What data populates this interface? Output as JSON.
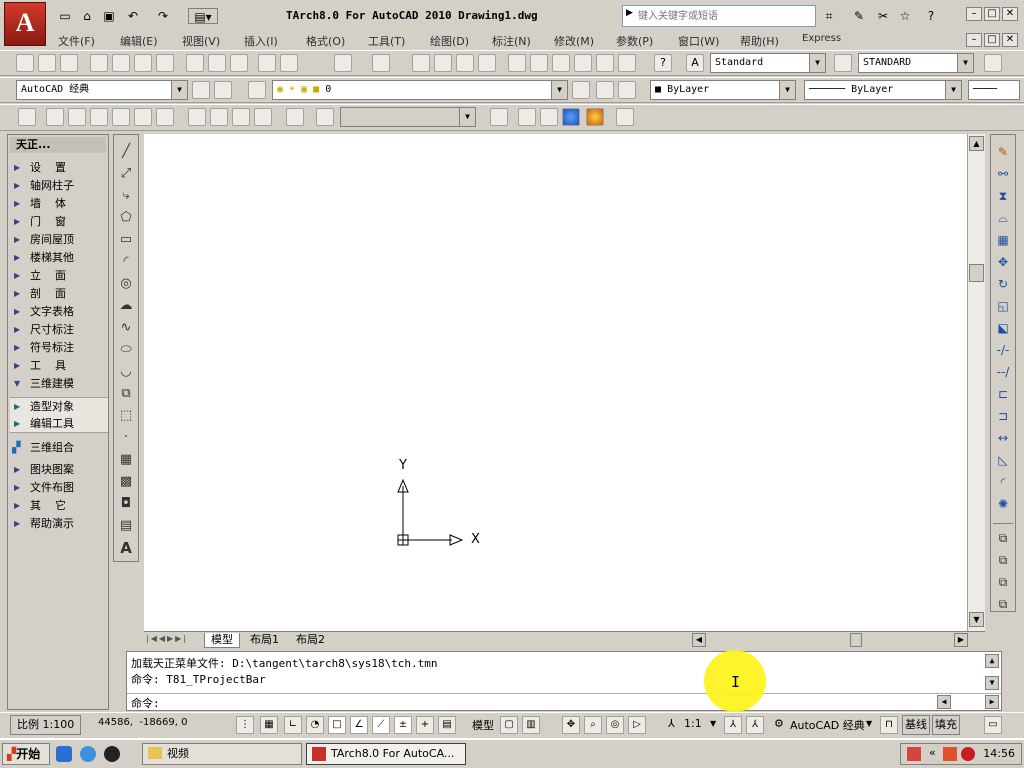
{
  "window": {
    "title": "TArch8.0 For AutoCAD 2010  Drawing1.dwg",
    "logo": "A",
    "search_placeholder": "键入关键字或短语"
  },
  "menu": [
    "文件(F)",
    "编辑(E)",
    "视图(V)",
    "插入(I)",
    "格式(O)",
    "工具(T)",
    "绘图(D)",
    "标注(N)",
    "修改(M)",
    "参数(P)",
    "窗口(W)",
    "帮助(H)",
    "Express"
  ],
  "toolbars": {
    "text_style": "Standard",
    "dim_style": "STANDARD",
    "workspace": "AutoCAD 经典",
    "layer": "0",
    "color": "ByLayer",
    "linetype": "ByLayer"
  },
  "tianzheng": {
    "title": "天正...",
    "items": [
      {
        "label": "设    置",
        "state": "collapsed"
      },
      {
        "label": "轴网柱子",
        "state": "collapsed"
      },
      {
        "label": "墙    体",
        "state": "collapsed"
      },
      {
        "label": "门    窗",
        "state": "collapsed"
      },
      {
        "label": "房间屋顶",
        "state": "collapsed"
      },
      {
        "label": "楼梯其他",
        "state": "collapsed"
      },
      {
        "label": "立    面",
        "state": "collapsed"
      },
      {
        "label": "剖    面",
        "state": "collapsed"
      },
      {
        "label": "文字表格",
        "state": "collapsed"
      },
      {
        "label": "尺寸标注",
        "state": "collapsed"
      },
      {
        "label": "符号标注",
        "state": "collapsed"
      },
      {
        "label": "工    具",
        "state": "collapsed"
      },
      {
        "label": "三维建模",
        "state": "expanded"
      },
      {
        "label": "造型对象",
        "state": "sub"
      },
      {
        "label": "编辑工具",
        "state": "sub"
      },
      {
        "label": "三维组合",
        "state": "special"
      },
      {
        "label": "图块图案",
        "state": "collapsed"
      },
      {
        "label": "文件布图",
        "state": "collapsed"
      },
      {
        "label": "其    它",
        "state": "collapsed"
      },
      {
        "label": "帮助演示",
        "state": "collapsed"
      }
    ]
  },
  "ucs": {
    "x_label": "X",
    "y_label": "Y"
  },
  "layout_tabs": [
    "模型",
    "布局1",
    "布局2"
  ],
  "command": {
    "line1": "加载天正菜单文件: D:\\tangent\\tarch8\\sys18\\tch.tmn",
    "line2": "命令: T81_TProjectBar",
    "prompt": "命令:"
  },
  "status": {
    "scale": "比例 1:100",
    "coords": "44586,  -18669, 0",
    "model": "模型",
    "annot_scale": "1:1",
    "workspace": "AutoCAD 经典",
    "baseline": "基线",
    "fill": "填充"
  },
  "taskbar": {
    "start": "开始",
    "folder": "视频",
    "app": "TArch8.0 For AutoCA...",
    "clock": "14:56"
  }
}
